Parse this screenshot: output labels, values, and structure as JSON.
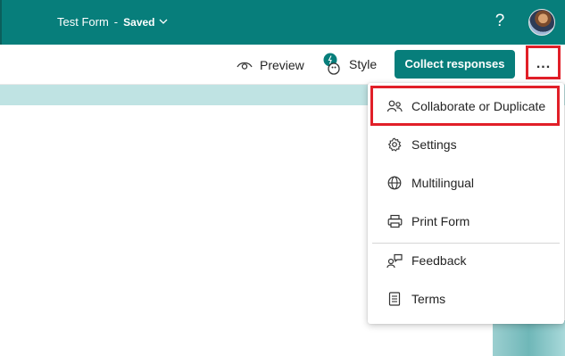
{
  "header": {
    "form_title": "Test Form",
    "separator": "-",
    "save_status": "Saved",
    "help_label": "?",
    "bar_color": "#077e7b"
  },
  "toolbar": {
    "preview_label": "Preview",
    "style_label": "Style",
    "collect_label": "Collect responses",
    "more_label": "..."
  },
  "menu": {
    "items": [
      {
        "label": "Collaborate or Duplicate",
        "icon": "people-icon"
      },
      {
        "label": "Settings",
        "icon": "gear-icon"
      },
      {
        "label": "Multilingual",
        "icon": "globe-icon"
      },
      {
        "label": "Print Form",
        "icon": "printer-icon"
      },
      {
        "label": "Feedback",
        "icon": "feedback-icon"
      },
      {
        "label": "Terms",
        "icon": "document-icon"
      }
    ]
  },
  "colors": {
    "accent": "#077e7b",
    "highlight": "#e11f28",
    "band": "#bfe3e3"
  }
}
